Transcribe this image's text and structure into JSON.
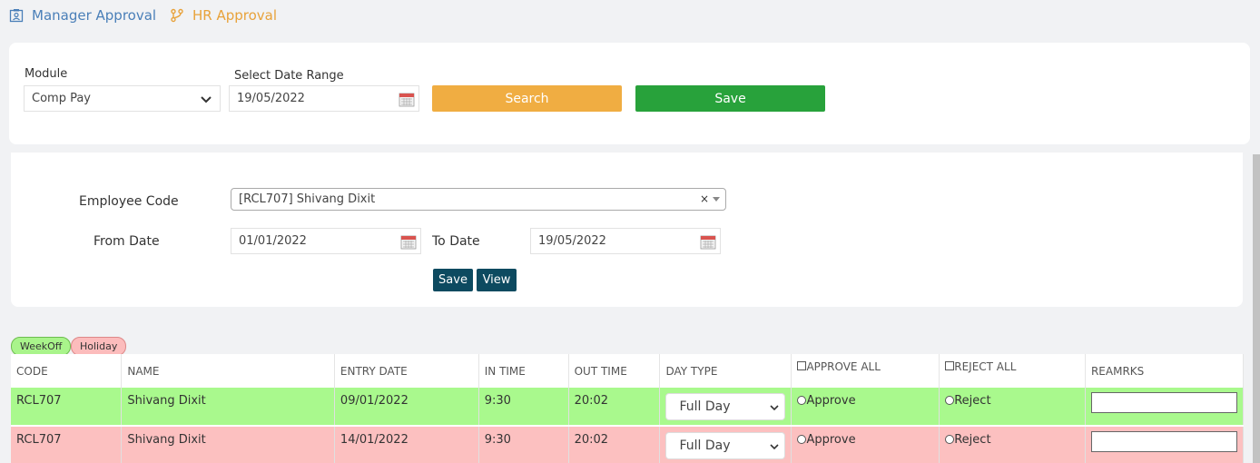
{
  "tabs": {
    "manager": "Manager Approval",
    "hr": "HR Approval"
  },
  "filter": {
    "module_label": "Module",
    "module_value": "Comp Pay",
    "date_range_label": "Select Date Range",
    "date_range_value": "19/05/2022",
    "search_label": "Search",
    "save_label": "Save"
  },
  "employee": {
    "code_label": "Employee Code",
    "code_value": "[RCL707] Shivang Dixit",
    "clear": "×",
    "from_label": "From Date",
    "from_value": "01/01/2022",
    "to_label": "To Date",
    "to_value": "19/05/2022",
    "save_label": "Save",
    "view_label": "View"
  },
  "legend": {
    "weekoff": "WeekOff",
    "holiday": "Holiday"
  },
  "table": {
    "headers": [
      "CODE",
      "NAME",
      "ENTRY DATE",
      "IN TIME",
      "OUT TIME",
      "DAY TYPE",
      "APPROVE ALL",
      "REJECT ALL",
      "REAMRKS"
    ],
    "rows": [
      {
        "code": "RCL707",
        "name": "Shivang Dixit",
        "entry_date": "09/01/2022",
        "in_time": "9:30",
        "out_time": "20:02",
        "day_type": "Full Day",
        "approve": "Approve",
        "reject": "Reject",
        "type": "weekoff"
      },
      {
        "code": "RCL707",
        "name": "Shivang Dixit",
        "entry_date": "14/01/2022",
        "in_time": "9:30",
        "out_time": "20:02",
        "day_type": "Full Day",
        "approve": "Approve",
        "reject": "Reject",
        "type": "holiday"
      }
    ]
  },
  "colors": {
    "weekoff": "#a9f98d",
    "holiday": "#fcc0c0",
    "search": "#f0ad42",
    "save": "#28a23b",
    "dark_button": "#0d4a60"
  }
}
